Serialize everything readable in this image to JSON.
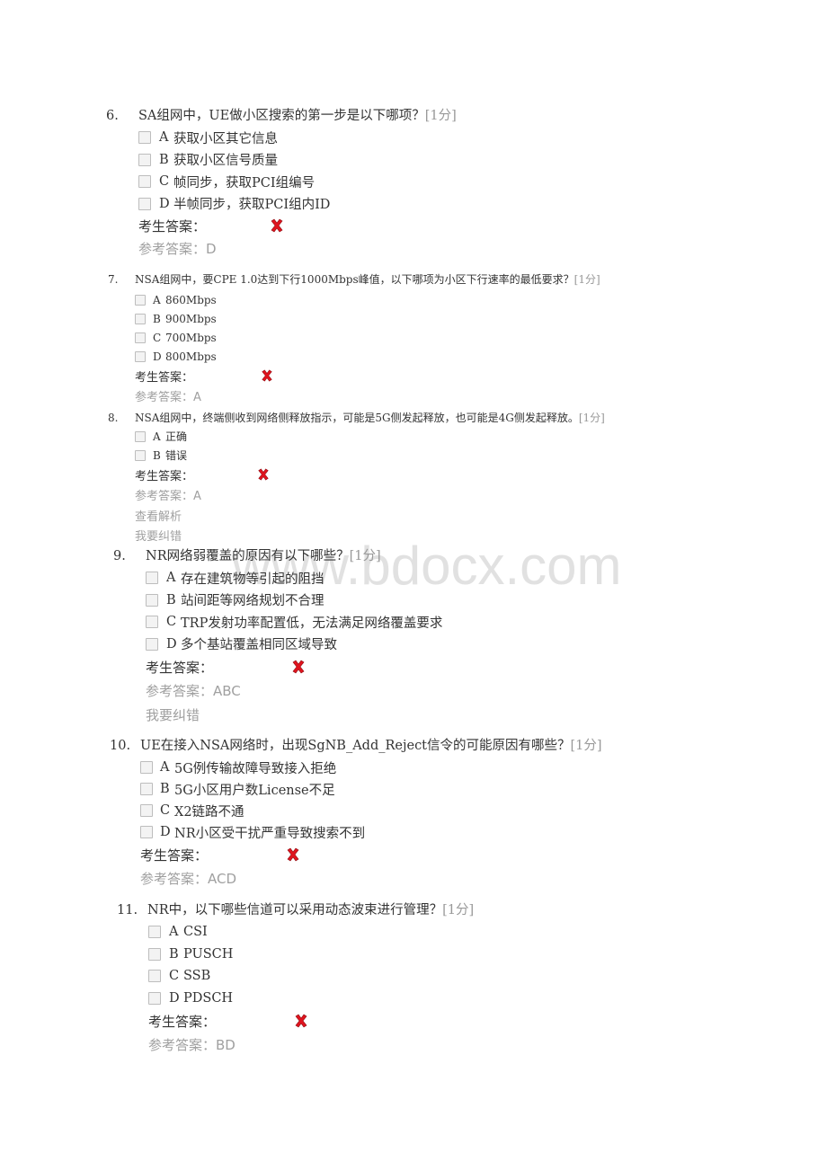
{
  "labels": {
    "student_answer": "考生答案：",
    "reference_answer_prefix": "参考答案："
  },
  "watermark": "www.bdocx.com",
  "colors": {
    "wrong_mark": "#e0141e",
    "muted_text": "#a0a0a0",
    "body_text": "#333333"
  },
  "questions": [
    {
      "number": "6.",
      "text": "SA组网中，UE做小区搜索的第一步是以下哪项？",
      "score": "[1分]",
      "options": [
        {
          "letter": "A",
          "text": "获取小区其它信息"
        },
        {
          "letter": "B",
          "text": "获取小区信号质量"
        },
        {
          "letter": "C",
          "text": "帧同步，获取PCI组编号"
        },
        {
          "letter": "D",
          "text": "半帧同步，获取PCI组内ID"
        }
      ],
      "student_answer_label": "考生答案：",
      "result_icon": "wrong-x-icon",
      "reference_answer": "参考答案：D",
      "links": []
    },
    {
      "number": "7.",
      "text": "NSA组网中，要CPE 1.0达到下行1000Mbps峰值，以下哪项为小区下行速率的最低要求？",
      "score": "[1分]",
      "options": [
        {
          "letter": "A",
          "text": "860Mbps"
        },
        {
          "letter": "B",
          "text": "900Mbps"
        },
        {
          "letter": "C",
          "text": "700Mbps"
        },
        {
          "letter": "D",
          "text": "800Mbps"
        }
      ],
      "student_answer_label": "考生答案：",
      "result_icon": "wrong-x-icon",
      "reference_answer": "参考答案：A",
      "links": []
    },
    {
      "number": "8.",
      "text": "NSA组网中，终端侧收到网络侧释放指示，可能是5G侧发起释放，也可能是4G侧发起释放。",
      "score": "[1分]",
      "options": [
        {
          "letter": "A",
          "text": "正确"
        },
        {
          "letter": "B",
          "text": "错误"
        }
      ],
      "student_answer_label": "考生答案：",
      "result_icon": "wrong-x-icon",
      "reference_answer": "参考答案：A",
      "links": [
        "查看解析",
        "我要纠错"
      ]
    },
    {
      "number": "9.",
      "text": "NR网络弱覆盖的原因有以下哪些？",
      "score": "[1分]",
      "options": [
        {
          "letter": "A",
          "text": "存在建筑物等引起的阻挡"
        },
        {
          "letter": "B",
          "text": "站间距等网络规划不合理"
        },
        {
          "letter": "C",
          "text": "TRP发射功率配置低，无法满足网络覆盖要求"
        },
        {
          "letter": "D",
          "text": "多个基站覆盖相同区域导致"
        }
      ],
      "student_answer_label": "考生答案：",
      "result_icon": "wrong-x-icon",
      "reference_answer": "参考答案：ABC",
      "links": [
        "我要纠错"
      ]
    },
    {
      "number": "10.",
      "text": "UE在接入NSA网络时，出现SgNB_Add_Reject信令的可能原因有哪些？",
      "score": "[1分]",
      "options": [
        {
          "letter": "A",
          "text": "5G例传输故障导致接入拒绝"
        },
        {
          "letter": "B",
          "text": "5G小区用户数License不足"
        },
        {
          "letter": "C",
          "text": "X2链路不通"
        },
        {
          "letter": "D",
          "text": "NR小区受干扰严重导致搜索不到"
        }
      ],
      "student_answer_label": "考生答案：",
      "result_icon": "wrong-x-icon",
      "reference_answer": "参考答案：ACD",
      "links": []
    },
    {
      "number": "11.",
      "text": "NR中，以下哪些信道可以采用动态波束进行管理？",
      "score": "[1分]",
      "options": [
        {
          "letter": "A",
          "text": "CSI"
        },
        {
          "letter": "B",
          "text": "PUSCH"
        },
        {
          "letter": "C",
          "text": "SSB"
        },
        {
          "letter": "D",
          "text": "PDSCH"
        }
      ],
      "student_answer_label": "考生答案：",
      "result_icon": "wrong-x-icon",
      "reference_answer": "参考答案：BD",
      "links": []
    }
  ]
}
